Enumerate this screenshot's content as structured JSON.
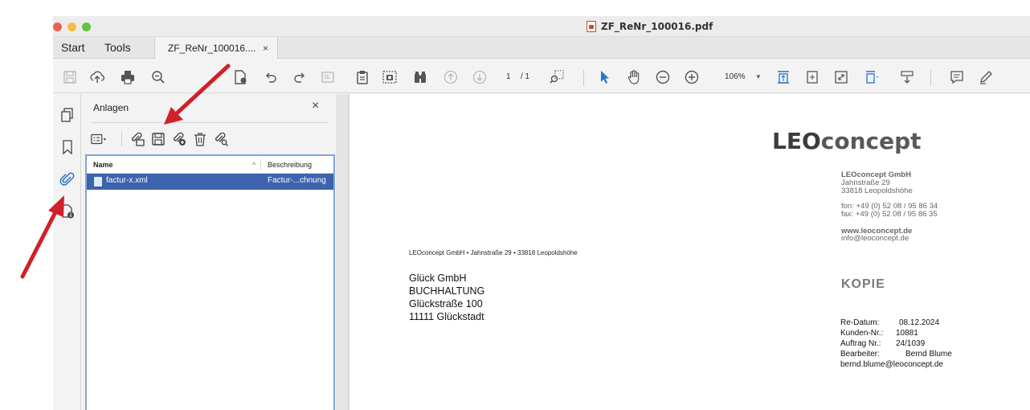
{
  "window": {
    "title": "ZF_ReNr_100016.pdf"
  },
  "tabs": {
    "start": "Start",
    "tools": "Tools",
    "document": "ZF_ReNr_100016....",
    "close": "×"
  },
  "toolbar": {
    "page_current": "1",
    "page_total": "/ 1",
    "zoom": "106%"
  },
  "attachments_panel": {
    "title": "Anlagen",
    "close": "×",
    "columns": {
      "name": "Name",
      "sort": "^",
      "description": "Beschreibung"
    },
    "files": [
      {
        "name": "factur-x.xml",
        "description": "Factur-...chnung"
      }
    ]
  },
  "document": {
    "logo_prefix": "LEO",
    "logo_suffix": "concept",
    "company": {
      "name": "LEOconcept GmbH",
      "street": "Jahnstraße 29",
      "city": "33818 Leopoldshöhe",
      "phone": "fon: +49 (0) 52 08 / 95 86 34",
      "fax": "fax: +49 (0) 52 08 / 95 86 35",
      "web": "www.leoconcept.de",
      "email": "info@leoconcept.de"
    },
    "sender_line": "LEOconcept GmbH • Jahnstraße 29 • 33818 Leopoldshöhe",
    "recipient": {
      "line1": "Glück GmbH",
      "line2": "BUCHHALTUNG",
      "line3": "Glückstraße 100",
      "line4": "11111  Glückstadt"
    },
    "stamp": "KOPIE",
    "meta": {
      "date_label": "Re-Datum:",
      "date_value": "08.12.2024",
      "customer_label": "Kunden-Nr.:",
      "customer_value": "10881",
      "order_label": "Auftrag Nr.:",
      "order_value": "24/1039",
      "clerk_label": "Bearbeiter:",
      "clerk_value": "Bernd Blume",
      "clerk_email": "bernd.blume@leoconcept.de"
    }
  },
  "colors": {
    "accent": "#2b72c9",
    "selection": "#3d63ad",
    "arrow": "#d0202a"
  }
}
